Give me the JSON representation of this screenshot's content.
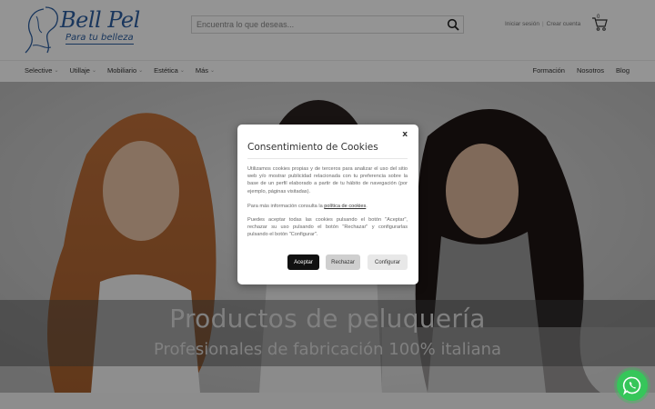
{
  "brand": {
    "name": "Bell Pel",
    "tagline": "Para tu belleza",
    "color": "#2c5ea0"
  },
  "search": {
    "placeholder": "Encuentra lo que deseas..."
  },
  "account": {
    "login": "Iniciar sesión",
    "register": "Crear cuenta",
    "cart_count": "0"
  },
  "nav": {
    "left": [
      {
        "label": "Selective"
      },
      {
        "label": "Utillaje"
      },
      {
        "label": "Mobiliario"
      },
      {
        "label": "Estética"
      },
      {
        "label": "Más"
      }
    ],
    "right": [
      {
        "label": "Formación"
      },
      {
        "label": "Nosotros"
      },
      {
        "label": "Blog"
      }
    ]
  },
  "hero": {
    "title": "Productos de peluquería",
    "subtitle": "Profesionales de fabricación 100% italiana"
  },
  "cookie_modal": {
    "close": "x",
    "title": "Consentimiento de Cookies",
    "paragraph1": "Utilizamos cookies propias y de terceros para analizar el uso del sitio web y/o mostrar publicidad relacionada con tu preferencia sobre la base de un perfil elaborado a partir de tu hábito de navegación (por ejemplo, páginas visitadas).",
    "paragraph2_prefix": "Para más información consulta la ",
    "paragraph2_link": "política de cookies",
    "paragraph2_suffix": ".",
    "paragraph3": "Puedes aceptar todas las cookies pulsando el botón \"Aceptar\", rechazar su uso pulsando el botón \"Rechazar\" y configurarlas pulsando el botón \"Configurar\".",
    "accept": "Aceptar",
    "reject": "Rechazar",
    "configure": "Configurar"
  },
  "icons": {
    "search": "search-icon",
    "cart": "cart-icon",
    "chevron": "chevron-down-icon",
    "whatsapp": "whatsapp-icon"
  }
}
